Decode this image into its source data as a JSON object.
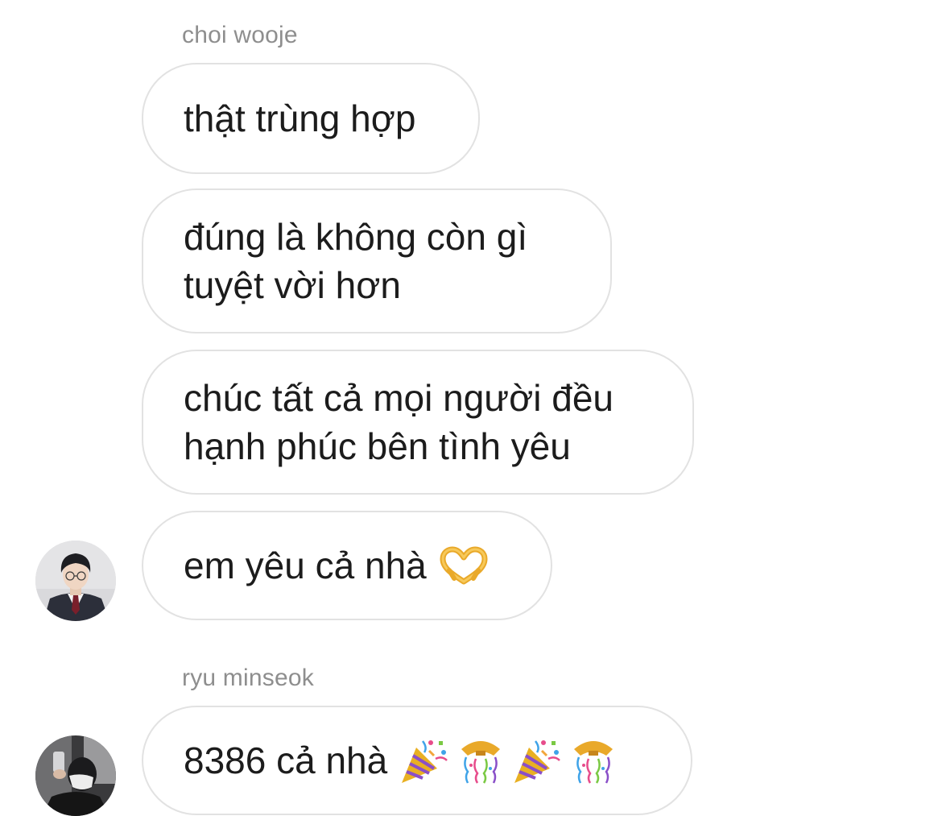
{
  "conversation": {
    "groups": [
      {
        "sender": "choi wooje",
        "messages": [
          {
            "text": "thật trùng hợp"
          },
          {
            "text": "đúng là không còn gì\ntuyệt vời hơn"
          },
          {
            "text": "chúc tất cả mọi người đều\nhạnh phúc bên tình yêu"
          },
          {
            "text": "em yêu cả nhà",
            "emoji": [
              "heart-hands-icon"
            ]
          }
        ]
      },
      {
        "sender": "ryu minseok",
        "messages": [
          {
            "text": "8386 cả nhà",
            "emoji": [
              "party-popper-icon",
              "confetti-ball-icon",
              "party-popper-icon",
              "confetti-ball-icon"
            ]
          }
        ]
      }
    ]
  }
}
